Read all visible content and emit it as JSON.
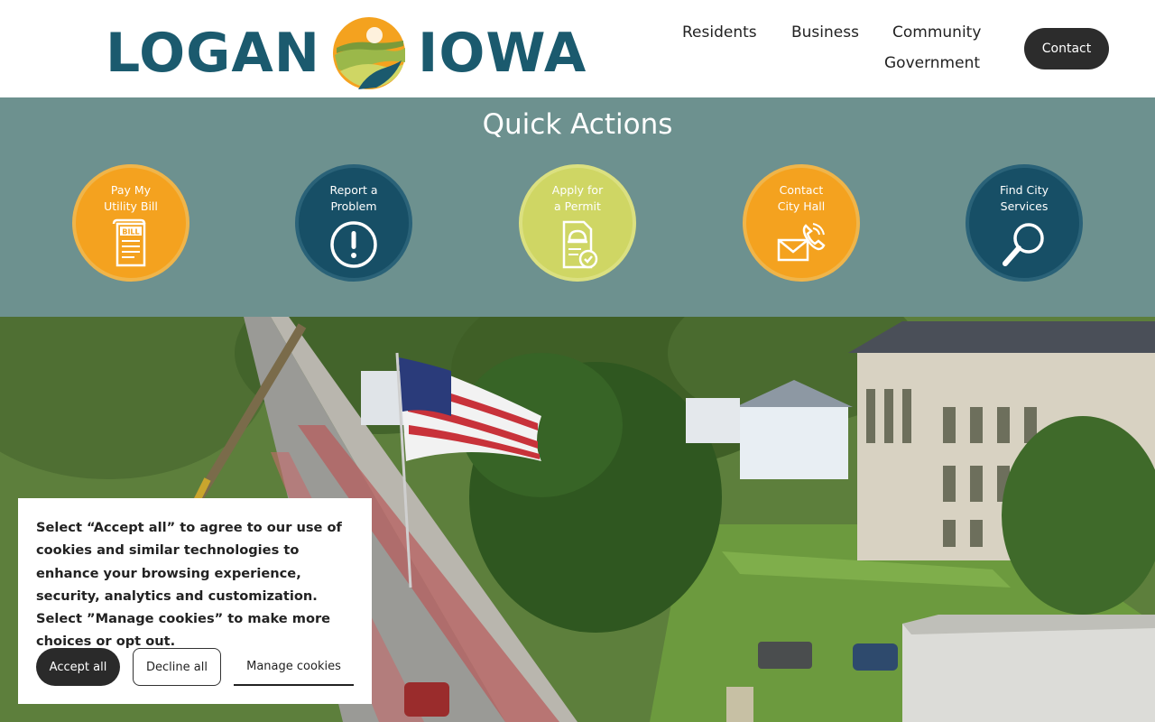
{
  "header": {
    "logo_left": "LOGAN",
    "logo_right": "IOWA",
    "nav": [
      "Residents",
      "Business",
      "Community",
      "Government"
    ],
    "contact_label": "Contact"
  },
  "quick_actions": {
    "title": "Quick Actions",
    "items": [
      {
        "label": "Pay My\nUtility Bill",
        "icon": "bill-scroll-icon",
        "color": "#f4a21f",
        "icon_text": "BILL"
      },
      {
        "label": "Report a\nProblem",
        "icon": "exclamation-circle-icon",
        "color": "#174f66"
      },
      {
        "label": "Apply for\na Permit",
        "icon": "permit-document-icon",
        "color": "#cfd664"
      },
      {
        "label": "Contact\nCity Hall",
        "icon": "envelope-phone-icon",
        "color": "#f4a21f"
      },
      {
        "label": "Find City\nServices",
        "icon": "magnifier-icon",
        "color": "#174f66"
      }
    ]
  },
  "cookie_banner": {
    "text": "Select “Accept all” to agree to our use of cookies and similar technologies to enhance your browsing experience, security, analytics and customization. Select ”Manage cookies” to make more choices or opt out.",
    "accept_label": "Accept all",
    "decline_label": "Decline all",
    "manage_label": "Manage cookies"
  },
  "colors": {
    "brand_dark": "#1b5a6e",
    "qa_background": "#6d918f",
    "orange": "#f4a21f",
    "teal": "#174f66",
    "lime": "#cfd664"
  }
}
